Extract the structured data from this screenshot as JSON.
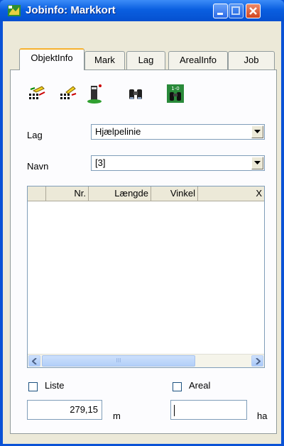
{
  "window": {
    "title": "Jobinfo: Markkort"
  },
  "tabs": [
    "ObjektInfo",
    "Mark",
    "Lag",
    "ArealInfo",
    "Job"
  ],
  "toolbar": {
    "icons": [
      "edit-points-icon",
      "edit-list-icon",
      "survey-point-icon",
      "binoculars-icon",
      "search-numbered-icon"
    ]
  },
  "form": {
    "lag_label": "Lag",
    "lag_value": "Hjælpelinie",
    "navn_label": "Navn",
    "navn_value": "[3]"
  },
  "table": {
    "columns": [
      "Nr.",
      "Længde",
      "Vinkel",
      "X"
    ],
    "rows": []
  },
  "checkboxes": {
    "liste_label": "Liste",
    "liste_checked": false,
    "areal_label": "Areal",
    "areal_checked": false
  },
  "values": {
    "length_value": "279,15",
    "length_unit": "m",
    "area_value": "",
    "area_unit": "ha"
  },
  "scrollbar": {
    "grip": "III"
  }
}
